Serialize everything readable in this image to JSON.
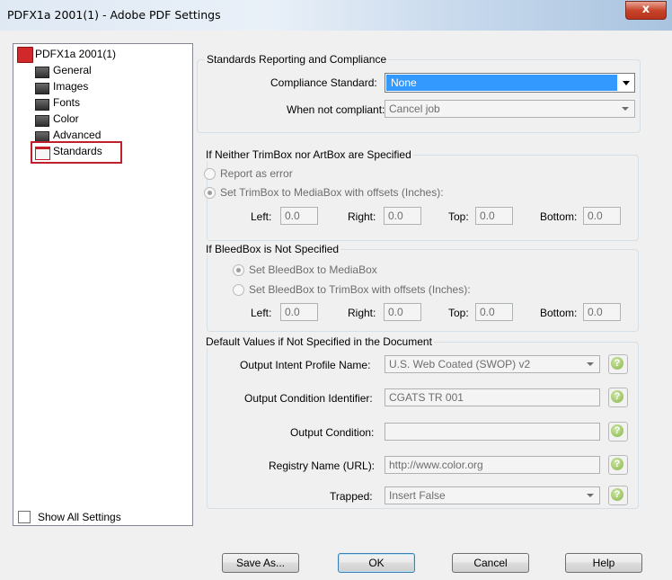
{
  "window": {
    "title": "PDFX1a 2001(1) - Adobe PDF Settings",
    "close_glyph": "x"
  },
  "tree": {
    "root_label": "PDFX1a 2001(1)",
    "items": [
      {
        "label": "General",
        "icon": "document-icon"
      },
      {
        "label": "Images",
        "icon": "document-icon"
      },
      {
        "label": "Fonts",
        "icon": "document-icon"
      },
      {
        "label": "Color",
        "icon": "document-icon"
      },
      {
        "label": "Advanced",
        "icon": "document-icon"
      },
      {
        "label": "Standards",
        "icon": "folder-icon",
        "selected": true
      }
    ]
  },
  "show_all_settings": {
    "label": "Show All Settings",
    "checked": false
  },
  "standards_group": {
    "title": "Standards Reporting and Compliance",
    "compliance_label": "Compliance Standard:",
    "compliance_value": "None",
    "not_compliant_label": "When not compliant:",
    "not_compliant_value": "Cancel job"
  },
  "trimbox_group": {
    "title": "If Neither TrimBox nor ArtBox are Specified",
    "option_error": "Report as error",
    "option_offsets": "Set TrimBox to MediaBox with offsets (Inches):",
    "selected": "option_offsets",
    "left_label": "Left:",
    "left_value": "0.0",
    "right_label": "Right:",
    "right_value": "0.0",
    "top_label": "Top:",
    "top_value": "0.0",
    "bottom_label": "Bottom:",
    "bottom_value": "0.0"
  },
  "bleedbox_group": {
    "title": "If BleedBox is Not Specified",
    "option_media": "Set BleedBox to MediaBox",
    "option_trim": "Set BleedBox to TrimBox with offsets (Inches):",
    "selected": "option_media",
    "left_label": "Left:",
    "left_value": "0.0",
    "right_label": "Right:",
    "right_value": "0.0",
    "top_label": "Top:",
    "top_value": "0.0",
    "bottom_label": "Bottom:",
    "bottom_value": "0.0"
  },
  "defaults_group": {
    "title": "Default Values if Not Specified in the Document",
    "intent_label": "Output Intent Profile Name:",
    "intent_value": "U.S. Web Coated (SWOP) v2",
    "condition_id_label": "Output Condition Identifier:",
    "condition_id_value": "CGATS TR 001",
    "condition_label": "Output Condition:",
    "condition_value": "",
    "registry_label": "Registry Name (URL):",
    "registry_value": "http://www.color.org",
    "trapped_label": "Trapped:",
    "trapped_value": "Insert False",
    "help_glyph": "?"
  },
  "buttons": {
    "save_as": "Save As...",
    "ok": "OK",
    "cancel": "Cancel",
    "help": "Help"
  },
  "colors": {
    "selection": "#3399ff",
    "highlight_box": "#c0202b",
    "help_icon": "#86b54a"
  }
}
